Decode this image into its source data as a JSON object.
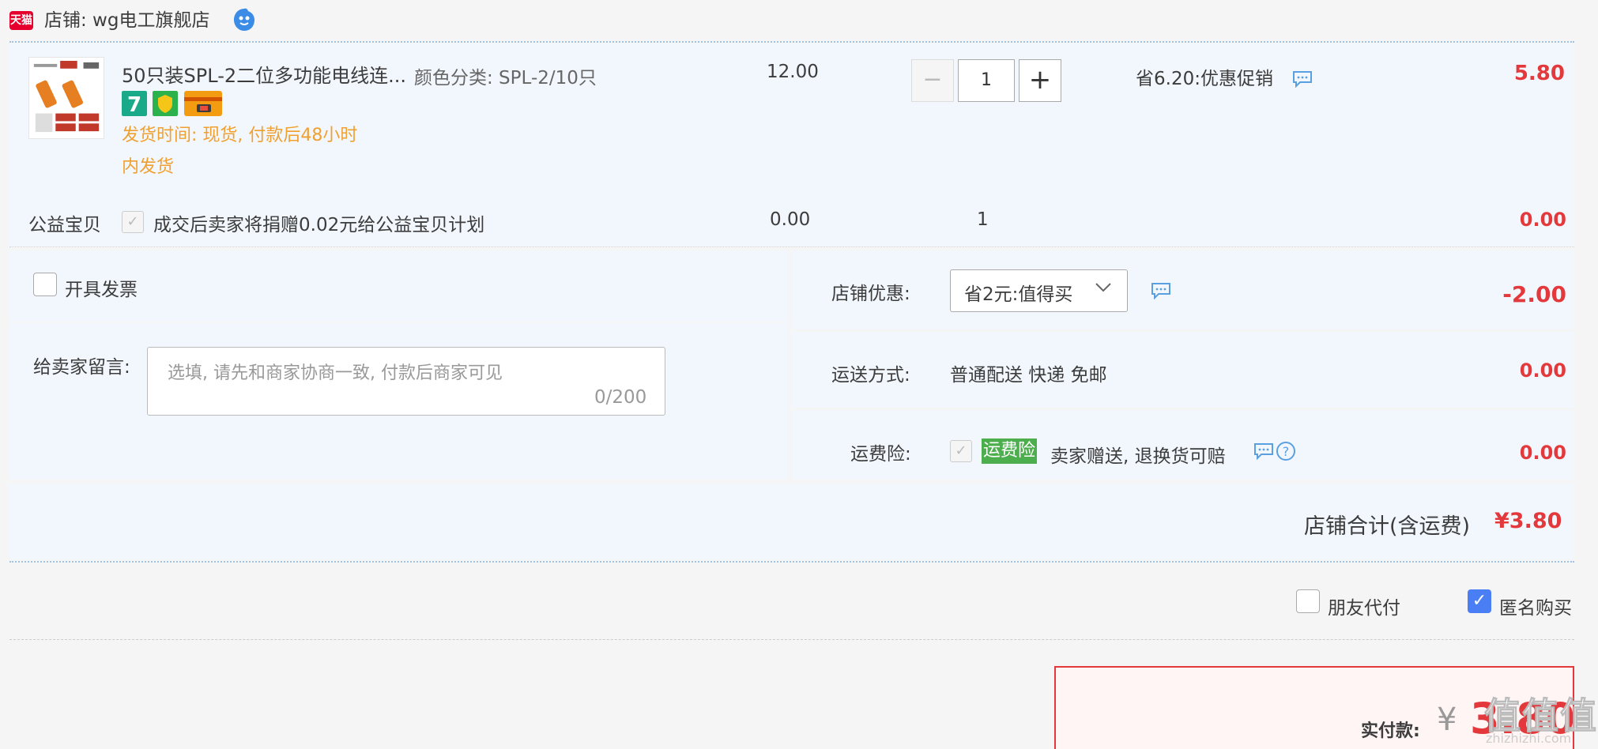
{
  "shop": {
    "badge": "天猫",
    "label": "店铺: wg电工旗舰店"
  },
  "item": {
    "title": "50只装SPL-2二位多功能电线连...",
    "sku": "颜色分类: SPL-2/10只",
    "ship_time_line1": "发货时间: 现货, 付款后48小时",
    "ship_time_line2": "内发货",
    "unit_price": "12.00",
    "quantity": "1",
    "qty_minus": "−",
    "qty_plus": "+",
    "promo": "省6.20:优惠促销",
    "subtotal": "5.80",
    "service_icons": [
      "7-day-return-icon",
      "shield-icon",
      "card-icon"
    ]
  },
  "charity": {
    "label": "公益宝贝",
    "check": "✓",
    "text": "成交后卖家将捐赠0.02元给公益宝贝计划",
    "price": "0.00",
    "quantity": "1",
    "amount": "0.00"
  },
  "invoice": {
    "label": "开具发票"
  },
  "message": {
    "label": "给卖家留言:",
    "placeholder": "选填, 请先和商家协商一致, 付款后商家可见",
    "count": "0/200"
  },
  "shop_discount": {
    "label": "店铺优惠:",
    "selected": "省2元:值得买",
    "amount": "-2.00"
  },
  "shipping": {
    "label": "运送方式:",
    "method": "普通配送 快递 免邮",
    "amount": "0.00"
  },
  "insurance": {
    "label": "运费险:",
    "check": "✓",
    "tag": "运费险",
    "text": "卖家赠送, 退换货可赔",
    "amount": "0.00"
  },
  "total": {
    "label": "店铺合计(含运费)",
    "value": "¥3.80"
  },
  "options": {
    "friend_pay": "朋友代付",
    "anonymous": "匿名购买",
    "anonymous_check": "✓"
  },
  "payment": {
    "label": "实付款:",
    "currency": "¥",
    "amount": "3.80"
  },
  "watermark": {
    "text": "值值值",
    "sub": "zhizhizhi.com"
  },
  "colors": {
    "accent_red": "#e4393c",
    "panel_bg": "#f2f7fd",
    "promo_orange": "#f0a030",
    "checkbox_blue": "#4a7ef5",
    "insurance_green": "#4cae4c"
  }
}
